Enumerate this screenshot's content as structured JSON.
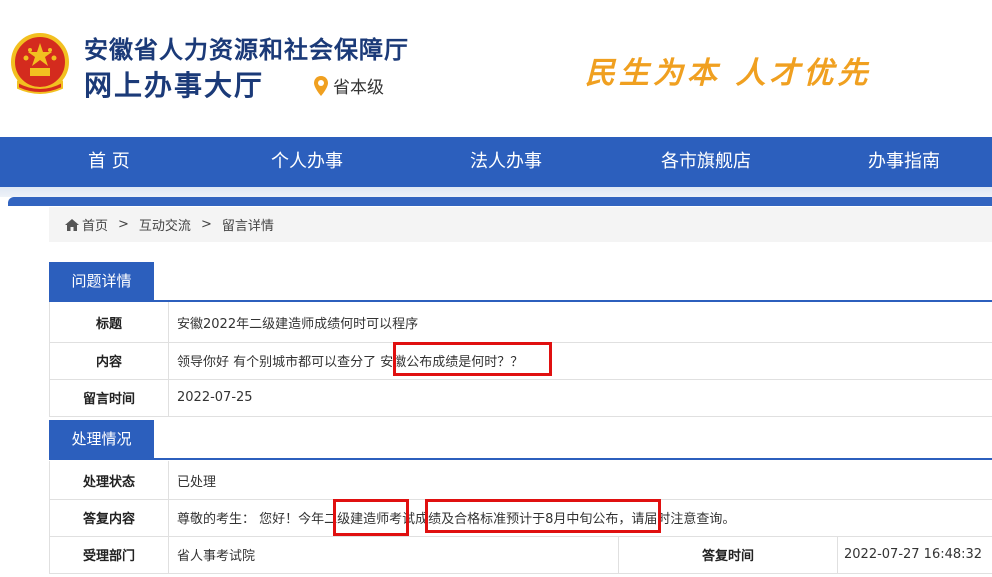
{
  "header": {
    "title_line1": "安徽省人力资源和社会保障厅",
    "title_line2": "网上办事大厅",
    "location": "省本级",
    "slogan": "民生为本 人才优先"
  },
  "nav": {
    "items": [
      "首 页",
      "个人办事",
      "法人办事",
      "各市旗舰店",
      "办事指南"
    ]
  },
  "breadcrumb": {
    "items": [
      "首页",
      "互动交流",
      "留言详情"
    ],
    "separator": ">"
  },
  "question": {
    "section_title": "问题详情",
    "title_label": "标题",
    "title_value": "安徽2022年二级建造师成绩何时可以程序",
    "content_label": "内容",
    "content_value": "领导你好 有个别城市都可以查分了 安徽公布成绩是何时？？",
    "time_label": "留言时间",
    "time_value": "2022-07-25"
  },
  "handling": {
    "section_title": "处理情况",
    "status_label": "处理状态",
    "status_value": "已处理",
    "reply_label": "答复内容",
    "reply_value": "尊敬的考生： 您好！今年二级建造师考试成绩及合格标准预计于8月中旬公布，请届时注意查询。",
    "dept_label": "受理部门",
    "dept_value": "省人事考试院",
    "reply_time_label": "答复时间",
    "reply_time_value": "2022-07-27 16:48:32"
  },
  "colors": {
    "brand_blue": "#2c5fbd",
    "title_blue": "#1b3a78",
    "slogan_orange": "#f0a020",
    "highlight_red": "#e01010"
  },
  "icons": [
    "national-emblem-icon",
    "location-pin-icon",
    "home-icon"
  ]
}
